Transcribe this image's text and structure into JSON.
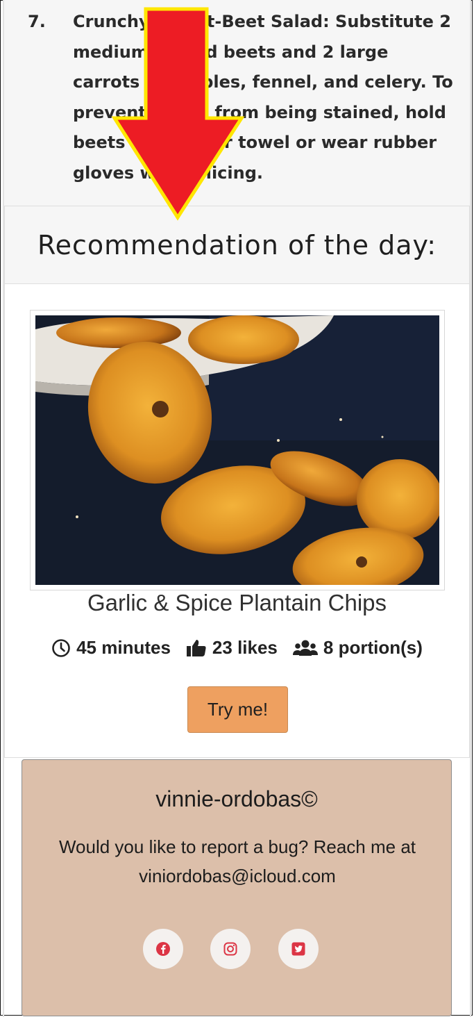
{
  "instructions": {
    "step_number": "7.",
    "step_text": "Crunchy Carrot-Beet Salad: Substitute 2 medium peeled beets and 2 large carrots for apples, fennel, and celery. To prevent hands from being stained, hold beets with paper towel or wear rubber gloves when slicing."
  },
  "recommendation": {
    "heading": "Recommendation of the day:",
    "image_icon": "plantain-chips-photo",
    "title": "Garlic & Spice Plantain Chips",
    "stats": {
      "time": "45 minutes",
      "likes": "23 likes",
      "portions": "8 portion(s)"
    },
    "button_label": "Try me!"
  },
  "footer": {
    "brand": "vinnie-ordobas©",
    "message": "Would you like to report a bug? Reach me at viniordobas@icloud.com",
    "social": [
      "facebook-icon",
      "instagram-icon",
      "twitter-icon"
    ]
  },
  "colors": {
    "accent_button": "#eea060",
    "footer_bg": "#dcbfaa",
    "social_icon": "#dc3545",
    "annotation_arrow": "#ed1c24",
    "annotation_arrow_outline": "#ffe600"
  }
}
